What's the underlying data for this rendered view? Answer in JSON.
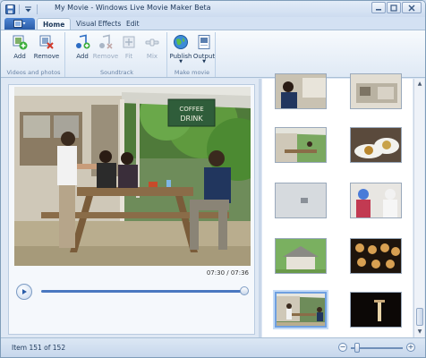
{
  "window": {
    "title": "My Movie - Windows Live Movie Maker Beta"
  },
  "tabs": [
    {
      "label": "Home",
      "active": true
    },
    {
      "label": "Visual Effects",
      "active": false
    },
    {
      "label": "Edit",
      "active": false
    }
  ],
  "ribbon": {
    "groups": {
      "videos": {
        "label": "Videos and photos",
        "add": "Add",
        "remove": "Remove"
      },
      "soundtrack": {
        "label": "Soundtrack",
        "add": "Add",
        "remove": "Remove",
        "fit": "Fit",
        "mix": "Mix"
      },
      "make_movie": {
        "label": "Make movie",
        "publish": "Publish",
        "output": "Output"
      }
    }
  },
  "preview": {
    "sign_text": "COFFEE DRINK",
    "time": "07:30 / 07:36",
    "progress": 0.986
  },
  "status": {
    "item_text": "Item 151 of 152",
    "zoom_level": 0.12
  },
  "colors": {
    "accent": "#4a78c0",
    "selection": "#6fa0e0"
  },
  "icons": [
    "save-icon",
    "undo-icon",
    "dropdown-icon",
    "minimize-icon",
    "maximize-icon",
    "close-icon",
    "play-icon",
    "zoom-in-icon",
    "zoom-out-icon"
  ]
}
